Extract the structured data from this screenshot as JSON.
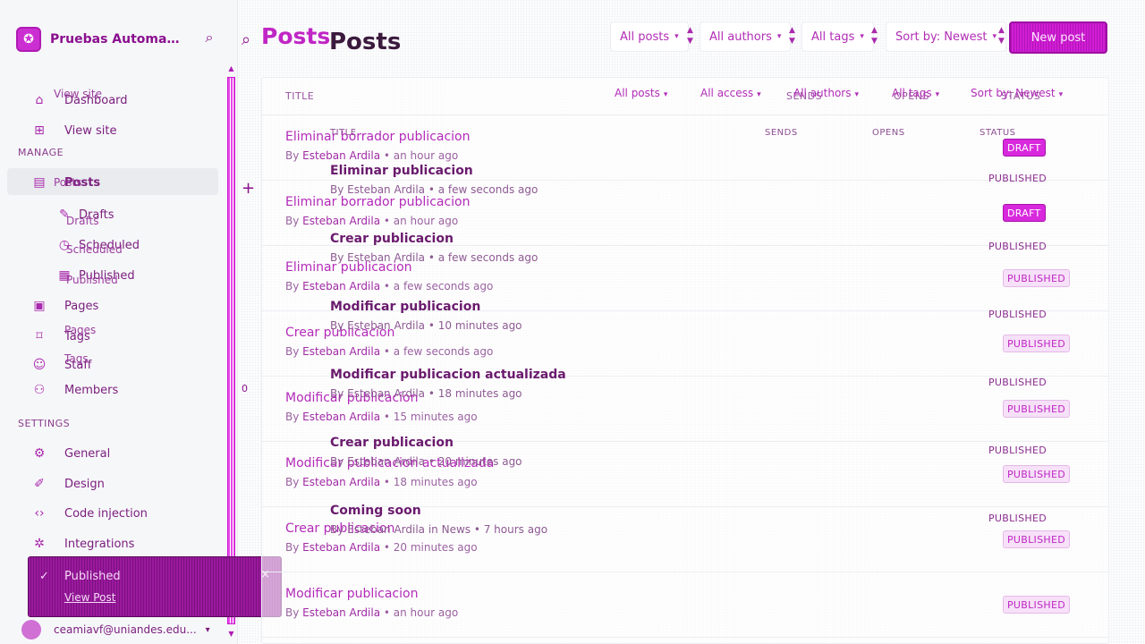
{
  "brand": {
    "title": "Pruebas Automatizadas",
    "logo_glyph": "✪",
    "search_icon": "search-icon"
  },
  "sidebar": {
    "top_items": [
      {
        "label": "Dashboard",
        "icon": "home-icon",
        "glyph": "⌂"
      },
      {
        "label": "View site",
        "icon": "view-site-icon",
        "glyph": "⊞"
      }
    ],
    "manage_label": "MANAGE",
    "manage_items": [
      {
        "label": "Posts",
        "icon": "posts-icon",
        "glyph": "▤"
      },
      {
        "label": "Drafts",
        "icon": "pencil-icon",
        "glyph": "✎"
      },
      {
        "label": "Scheduled",
        "icon": "clock-icon",
        "glyph": "◷"
      },
      {
        "label": "Published",
        "icon": "document-icon",
        "glyph": "▦"
      },
      {
        "label": "Pages",
        "icon": "pages-icon",
        "glyph": "▣"
      },
      {
        "label": "Tags",
        "icon": "tag-icon",
        "glyph": "⌑"
      },
      {
        "label": "Staff",
        "icon": "staff-icon",
        "glyph": "☺"
      },
      {
        "label": "Members",
        "icon": "members-icon",
        "glyph": "⚇"
      }
    ],
    "settings_label": "SETTINGS",
    "settings_items": [
      {
        "label": "General",
        "icon": "gear-icon",
        "glyph": "⚙"
      },
      {
        "label": "Design",
        "icon": "brush-icon",
        "glyph": "✐"
      },
      {
        "label": "Code injection",
        "icon": "code-icon",
        "glyph": "‹›"
      },
      {
        "label": "Integrations",
        "icon": "integrations-icon",
        "glyph": "✲"
      }
    ],
    "user_email": "ceamiavf@uniandes.edu..."
  },
  "toast": {
    "title": "Published",
    "link": "View Post",
    "close": "×",
    "check": "✓"
  },
  "header": {
    "title": "Posts",
    "title_echo": "Posts",
    "filters": {
      "posts": "All posts",
      "authors": "All authors",
      "tags": "All tags",
      "sort": "Sort by: Newest"
    },
    "new_post": "New post"
  },
  "list": {
    "columns": {
      "title": "TITLE",
      "sends": "SENDS",
      "opens": "OPENS",
      "status": "STATUS"
    },
    "sub_filters": {
      "posts": "All posts",
      "access": "All access",
      "authors": "All authors",
      "tags": "All tags",
      "sort": "Sort by: Newest"
    },
    "rows": [
      {
        "title": "Eliminar borrador publicacion",
        "by": "By",
        "author": "Esteban Ardila",
        "time": "an hour ago",
        "status": "DRAFT",
        "compact": true
      },
      {
        "title": "Eliminar borrador publicacion",
        "by": "By",
        "author": "Esteban Ardila",
        "time": "an hour ago",
        "status": "DRAFT",
        "compact": true
      },
      {
        "title": "Eliminar publicacion",
        "by": "By",
        "author": "Esteban Ardila",
        "time": "a few seconds ago",
        "status": "PUBLISHED",
        "compact": false
      },
      {
        "title": "Crear publicacion",
        "by": "By",
        "author": "Esteban Ardila",
        "time": "a few seconds ago",
        "status": "PUBLISHED",
        "compact": false
      },
      {
        "title": "Modificar publicacion",
        "by": "By",
        "author": "Esteban Ardila",
        "time": "15 minutes ago",
        "status": "PUBLISHED",
        "compact": false
      },
      {
        "title": "Modificar publicacion actualizada",
        "by": "By",
        "author": "Esteban Ardila",
        "time": "18 minutes ago",
        "status": "PUBLISHED",
        "compact": false
      },
      {
        "title": "Crear publicacion",
        "by": "By",
        "author": "Esteban Ardila",
        "time": "20 minutes ago",
        "status": "PUBLISHED",
        "compact": false
      },
      {
        "title": "Modificar publicacion",
        "by": "By",
        "author": "Esteban Ardila",
        "time": "an hour ago",
        "status": "PUBLISHED",
        "compact": false
      }
    ]
  },
  "ghost_rows": [
    {
      "title": "Eliminar publicacion",
      "meta": "By Esteban Ardila • a few seconds ago",
      "status": "PUBLISHED"
    },
    {
      "title": "Crear publicacion",
      "meta": "By Esteban Ardila • a few seconds ago",
      "status": "PUBLISHED"
    },
    {
      "title": "Modificar publicacion",
      "meta": "By Esteban Ardila • 10 minutes ago",
      "status": "PUBLISHED"
    },
    {
      "title": "Modificar publicacion actualizada",
      "meta": "By Esteban Ardila • 18 minutes ago",
      "status": "PUBLISHED"
    },
    {
      "title": "Crear publicacion",
      "meta": "By Esteban Ardila • 20 minutes ago",
      "status": "PUBLISHED"
    },
    {
      "title": "Coming soon",
      "meta": "By Esteban Ardila in News • 7 hours ago",
      "status": "PUBLISHED"
    }
  ],
  "ghost_sidebar": {
    "view_site": "View site",
    "posts": "Posts",
    "drafts": "Drafts",
    "scheduled": "Scheduled",
    "published": "Published",
    "pages": "Pages",
    "tags": "Tags"
  },
  "ghost_header": {
    "title": "TITLE",
    "sends": "SENDS",
    "opens": "OPENS",
    "status": "STATUS"
  },
  "gutter": {
    "plus": "+",
    "zero": "0"
  },
  "colors": {
    "accent": "#d11ed6",
    "accent_dark": "#8a0f8e",
    "sidebar_bg": "#f6f7f9"
  }
}
